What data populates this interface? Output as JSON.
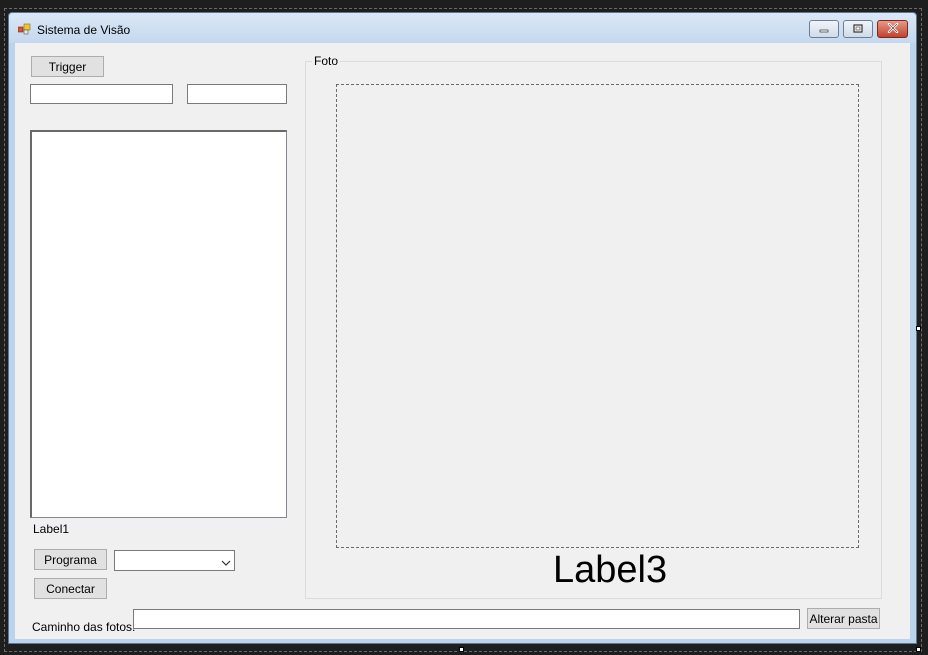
{
  "window": {
    "title": "Sistema de Visão"
  },
  "buttons": {
    "trigger": "Trigger",
    "programa": "Programa",
    "conectar": "Conectar",
    "alterar_pasta": "Alterar pasta"
  },
  "inputs": {
    "text1": "",
    "text2": "",
    "caminho": ""
  },
  "combo": {
    "selected": ""
  },
  "labels": {
    "label1": "Label1",
    "label3": "Label3",
    "caminho_das_fotos": "Caminho das fotos:"
  },
  "groupbox": {
    "caption": "Foto"
  },
  "icons": {
    "app": "app-icon",
    "minimize": "minimize-icon",
    "maximize": "maximize-icon",
    "close": "close-icon",
    "dropdown": "chevron-down-icon"
  }
}
